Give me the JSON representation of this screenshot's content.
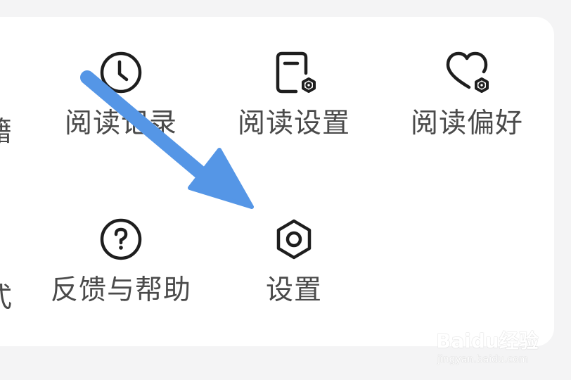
{
  "menu": {
    "row1": [
      {
        "label": "阅读记录",
        "icon": "clock-icon"
      },
      {
        "label": "阅读设置",
        "icon": "document-settings-icon"
      },
      {
        "label": "阅读偏好",
        "icon": "heart-settings-icon"
      }
    ],
    "row2": [
      {
        "label": "反馈与帮助",
        "icon": "question-circle-icon"
      },
      {
        "label": "设置",
        "icon": "hexagon-settings-icon"
      }
    ],
    "cut_left": [
      "籍",
      "式"
    ]
  },
  "annotation": {
    "arrow_color": "#5596e6"
  },
  "watermark": {
    "main": "Baidu经验",
    "sub": "jingyan.baidu.com"
  },
  "colors": {
    "background": "#f4f4f5",
    "card": "#ffffff",
    "text": "#4a4a4a",
    "icon": "#1e1e1e"
  }
}
